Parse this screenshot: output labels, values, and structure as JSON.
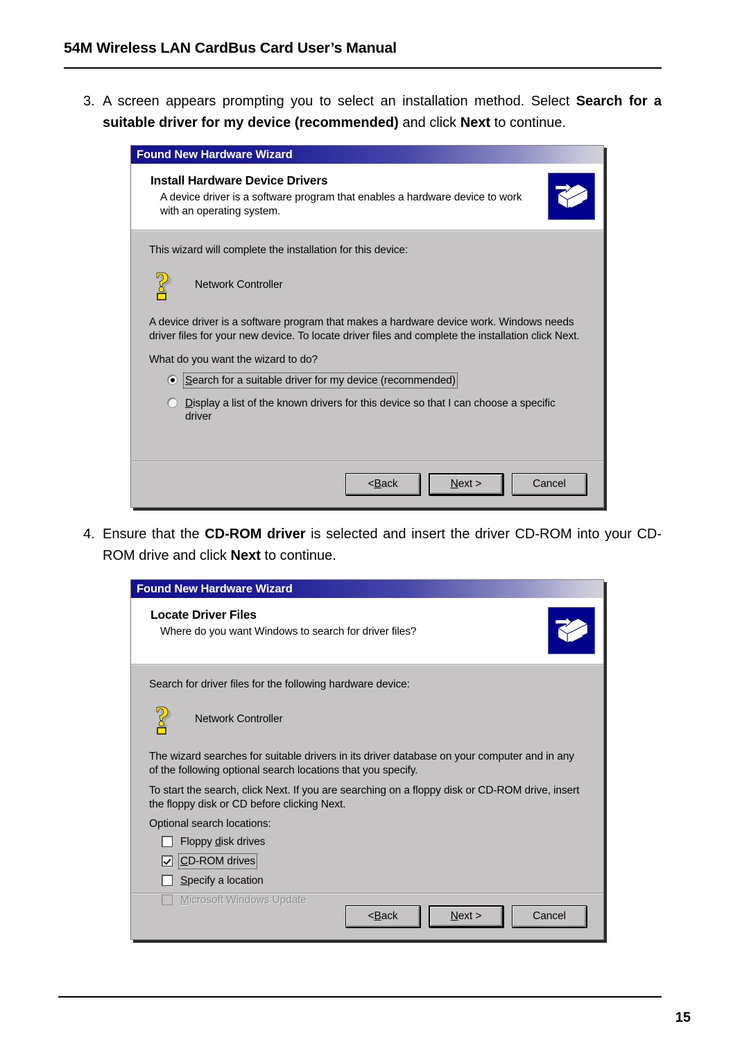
{
  "document": {
    "running_header": "54M Wireless LAN CardBus Card User’s Manual",
    "page_number": "15"
  },
  "steps": [
    {
      "number": "3.",
      "segments": [
        {
          "text": "A screen appears prompting you to select an installation method. Select ",
          "bold": false
        },
        {
          "text": "Search for a suitable driver for my device (recommended)",
          "bold": true
        },
        {
          "text": " and click ",
          "bold": false
        },
        {
          "text": "Next",
          "bold": true
        },
        {
          "text": " to continue.",
          "bold": false
        }
      ]
    },
    {
      "number": "4.",
      "segments": [
        {
          "text": "Ensure that the ",
          "bold": false
        },
        {
          "text": "CD-ROM driver",
          "bold": true
        },
        {
          "text": " is selected and insert the driver CD-ROM into your CD-ROM drive and click ",
          "bold": false
        },
        {
          "text": "Next",
          "bold": true
        },
        {
          "text": " to continue.",
          "bold": false
        }
      ]
    }
  ],
  "dialog1": {
    "titlebar": "Found New Hardware Wizard",
    "banner_title": "Install Hardware Device Drivers",
    "banner_subtitle": "A device driver is a software program that enables a hardware device to work with an operating system.",
    "banner_icon": "wizard-device-icon",
    "intro_text": "This wizard will complete the installation for this device:",
    "device_icon": "unknown-device-question-mark-icon",
    "device_name": "Network Controller",
    "description": "A device driver is a software program that makes a hardware device work. Windows needs driver files for your new device. To locate driver files and complete the installation click Next.",
    "question": "What do you want the wizard to do?",
    "options": [
      {
        "label": "Search for a suitable driver for my device (recommended)",
        "accel": "S",
        "selected": true,
        "focused": true
      },
      {
        "label": "Display a list of the known drivers for this device so that I can choose a specific driver",
        "accel": "D",
        "selected": false,
        "focused": false
      }
    ],
    "buttons": {
      "back": "< Back",
      "back_accel": "B",
      "next": "Next >",
      "next_accel": "N",
      "cancel": "Cancel",
      "default": "next"
    }
  },
  "dialog2": {
    "titlebar": "Found New Hardware Wizard",
    "banner_title": "Locate Driver Files",
    "banner_subtitle": "Where do you want Windows to search for driver files?",
    "banner_icon": "wizard-device-icon",
    "intro_text": "Search for driver files for the following hardware device:",
    "device_icon": "unknown-device-question-mark-icon",
    "device_name": "Network Controller",
    "description1": "The wizard searches for suitable drivers in its driver database on your computer and in any of the following optional search locations that you specify.",
    "description2": "To start the search, click Next. If you are searching on a floppy disk or CD-ROM drive, insert the floppy disk or CD before clicking Next.",
    "group_label": "Optional search locations:",
    "checkboxes": [
      {
        "label": "Floppy disk drives",
        "accel": "d",
        "checked": false,
        "focused": false,
        "disabled": false
      },
      {
        "label": "CD-ROM drives",
        "accel": "C",
        "checked": true,
        "focused": true,
        "disabled": false
      },
      {
        "label": "Specify a location",
        "accel": "S",
        "checked": false,
        "focused": false,
        "disabled": false
      },
      {
        "label": "Microsoft Windows Update",
        "accel": "M",
        "checked": false,
        "focused": false,
        "disabled": true
      }
    ],
    "buttons": {
      "back": "< Back",
      "back_accel": "B",
      "next": "Next >",
      "next_accel": "N",
      "cancel": "Cancel",
      "default": "next"
    }
  },
  "colors": {
    "titlebar_start": "#12128f",
    "titlebar_end": "#d4d2d2",
    "dialog_face": "#c6c4c4",
    "banner_background": "#ffffff",
    "banner_icon_background": "#00008f",
    "question_mark_yellow": "#ffe400",
    "disabled_text": "#8a8a8a"
  }
}
